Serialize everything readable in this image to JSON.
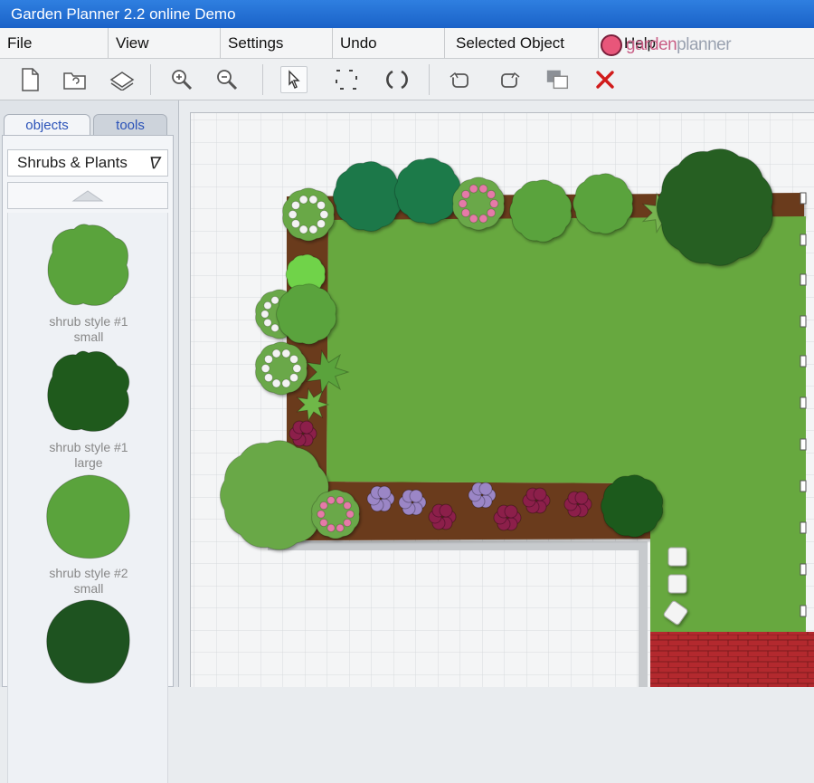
{
  "window": {
    "title": "Garden Planner 2.2 online Demo"
  },
  "menu": [
    {
      "label": "File"
    },
    {
      "label": "View"
    },
    {
      "label": "Settings"
    },
    {
      "label": "Undo"
    },
    {
      "label": "Selected Object"
    },
    {
      "label": "Help"
    }
  ],
  "logo": {
    "prefix": "garden",
    "suffix": "planner"
  },
  "toolbar": {
    "icons": [
      "new-file-icon",
      "open-file-icon",
      "save-icon",
      "zoom-in-icon",
      "zoom-out-icon",
      "select-pointer-icon",
      "marquee-select-icon",
      "rotate-icon",
      "rotate-left-icon",
      "rotate-right-icon",
      "layer-order-icon",
      "delete-icon"
    ],
    "delete_color": "#d11b1b"
  },
  "panel": {
    "tabs": [
      {
        "label": "objects"
      },
      {
        "label": "tools"
      }
    ],
    "category": "Shrubs & Plants",
    "items": [
      {
        "line1": "shrub style #1",
        "line2": "small",
        "color": "#5aa33c"
      },
      {
        "line1": "shrub style #1",
        "line2": "large",
        "color": "#1f5a1c"
      },
      {
        "line1": "shrub style #2",
        "line2": "small",
        "color": "#5aa33c"
      },
      {
        "line1": "",
        "line2": "",
        "color": "#1e5320"
      }
    ]
  },
  "colors": {
    "lawn": "#67a83f",
    "soil": "#6b3a1a",
    "grid_line": "#d7dadd",
    "grid_bg": "#f4f5f6",
    "paving": "#b3292e"
  }
}
